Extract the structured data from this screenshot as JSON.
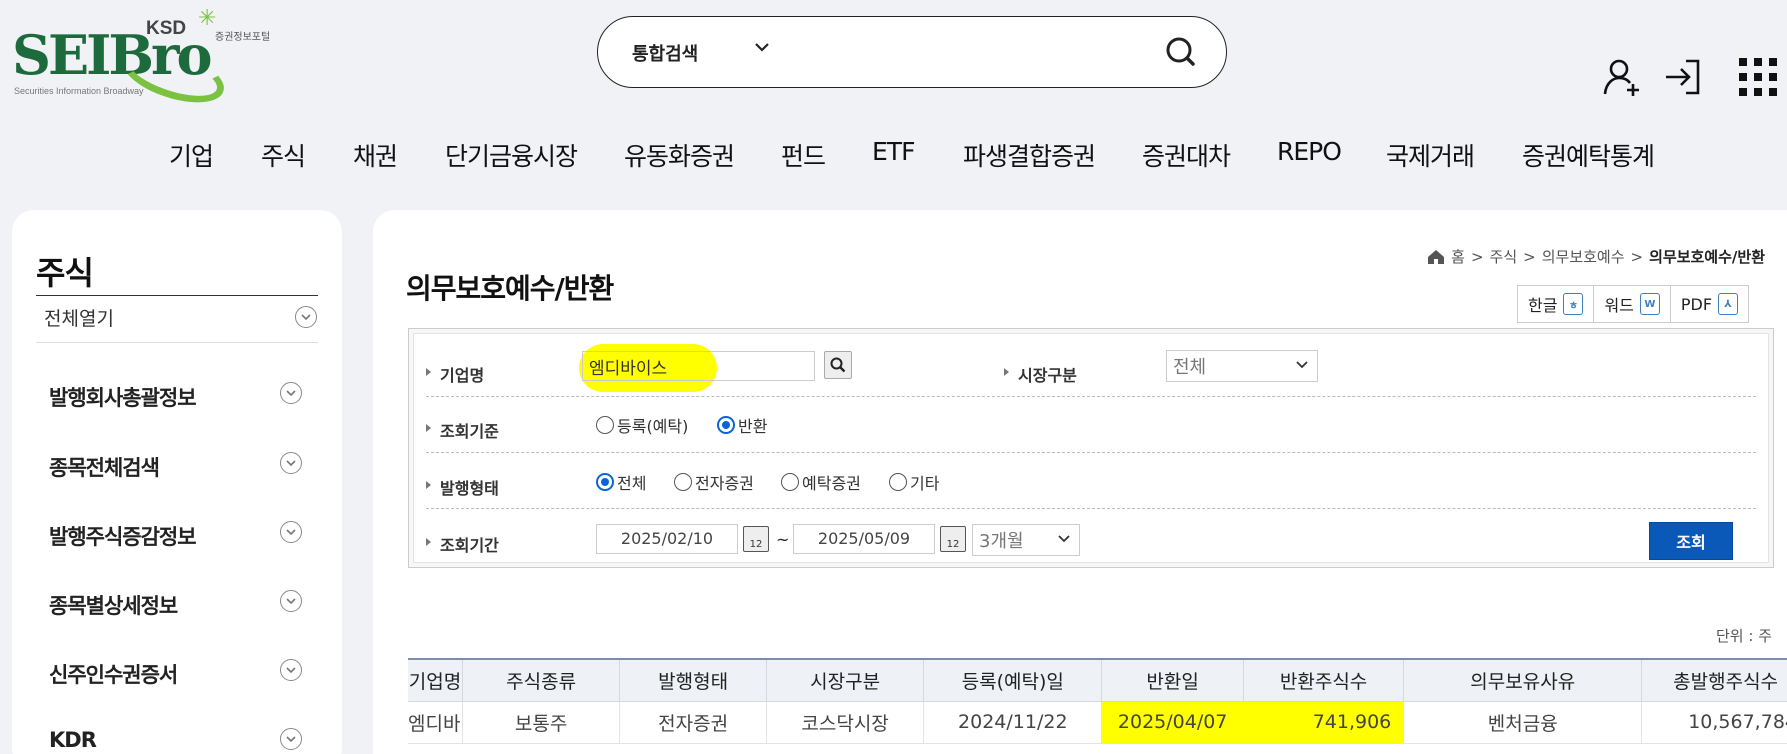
{
  "header": {
    "logo": {
      "brand": "SEIBro",
      "ksd": "KSD",
      "portal": "증권정보포털",
      "tagline": "Securities Information Broadway"
    },
    "search": {
      "type": "통합검색",
      "placeholder": "",
      "value": ""
    },
    "icons": [
      "user-add-icon",
      "login-icon",
      "grid-menu-icon"
    ]
  },
  "gnb": {
    "items": [
      "기업",
      "주식",
      "채권",
      "단기금융시장",
      "유동화증권",
      "펀드",
      "ETF",
      "파생결합증권",
      "증권대차",
      "REPO",
      "국제거래",
      "증권예탁통계"
    ]
  },
  "sidebar": {
    "title": "주식",
    "expand_all": "전체열기",
    "items": [
      "발행회사총괄정보",
      "종목전체검색",
      "발행주식증감정보",
      "종목별상세정보",
      "신주인수권증서",
      "KDR"
    ]
  },
  "breadcrumb": {
    "home": "홈",
    "level1": "주식",
    "level2": "의무보호예수",
    "current": "의무보호예수/반환"
  },
  "page": {
    "title": "의무보호예수/반환",
    "downloads": [
      {
        "label": "한글",
        "icon": "hwp-file-icon"
      },
      {
        "label": "워드",
        "icon": "word-file-icon"
      },
      {
        "label": "PDF",
        "icon": "pdf-file-icon"
      }
    ]
  },
  "form": {
    "company_label": "기업명",
    "company_value": "엠디바이스",
    "market_label": "시장구분",
    "market_value": "전체",
    "basis_label": "조회기준",
    "basis_options": [
      "등록(예탁)",
      "반환"
    ],
    "basis_selected": "반환",
    "issue_label": "발행형태",
    "issue_options": [
      "전체",
      "전자증권",
      "예탁증권",
      "기타"
    ],
    "issue_selected": "전체",
    "period_label": "조회기간",
    "date_from": "2025/02/10",
    "date_sep": "~",
    "date_to": "2025/05/09",
    "period_select": "3개월",
    "submit": "조회"
  },
  "unit_text": "단위 : 주",
  "table": {
    "headers": [
      "기업명",
      "주식종류",
      "발행형태",
      "시장구분",
      "등록(예탁)일",
      "반환일",
      "반환주식수",
      "의무보유사유",
      "총발행주식수"
    ],
    "rows": [
      [
        "엠디바이스",
        "보통주",
        "전자증권",
        "코스닥시장",
        "2024/11/22",
        "2025/04/07",
        "741,906",
        "벤처금융",
        "10,567,784"
      ]
    ]
  },
  "colors": {
    "accent": "#0a58b8",
    "highlight": "#ffff00",
    "logo_green": "#1d6b3c",
    "logo_lime": "#7cc242"
  }
}
